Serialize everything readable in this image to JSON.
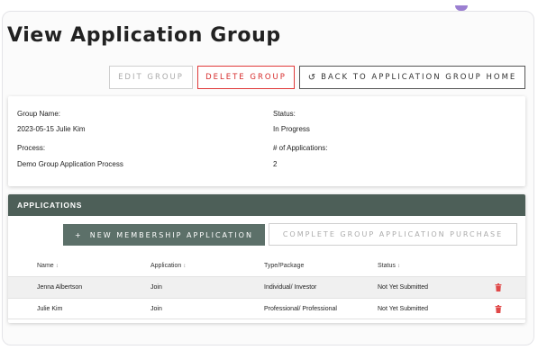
{
  "page": {
    "title": "View Application Group"
  },
  "actions": {
    "edit": "EDIT GROUP",
    "delete": "DELETE GROUP",
    "back": "BACK TO APPLICATION GROUP HOME",
    "back_icon": "undo-arrow-icon"
  },
  "group": {
    "name_label": "Group Name:",
    "name_value": "2023-05-15 Julie Kim",
    "status_label": "Status:",
    "status_value": "In Progress",
    "process_label": "Process:",
    "process_value": "Demo Group Application Process",
    "count_label": "# of Applications:",
    "count_value": "2"
  },
  "applications": {
    "header": "APPLICATIONS",
    "new_button": "NEW MEMBERSHIP APPLICATION",
    "new_icon": "+",
    "complete_button": "COMPLETE GROUP APPLICATION PURCHASE",
    "columns": [
      "Name",
      "Application",
      "Type/Package",
      "Status"
    ],
    "sort_glyph": "↕",
    "rows": [
      {
        "name": "Jenna Albertson",
        "application": "Join",
        "type": "Individual/ Investor",
        "status": "Not Yet Submitted"
      },
      {
        "name": "Julie Kim",
        "application": "Join",
        "type": "Professional/ Professional",
        "status": "Not Yet Submitted"
      }
    ],
    "delete_icon_color": "#e04848"
  },
  "colors": {
    "header_bg": "#4d5f58",
    "primary_button": "#5c7069",
    "danger": "#d62b2b"
  }
}
